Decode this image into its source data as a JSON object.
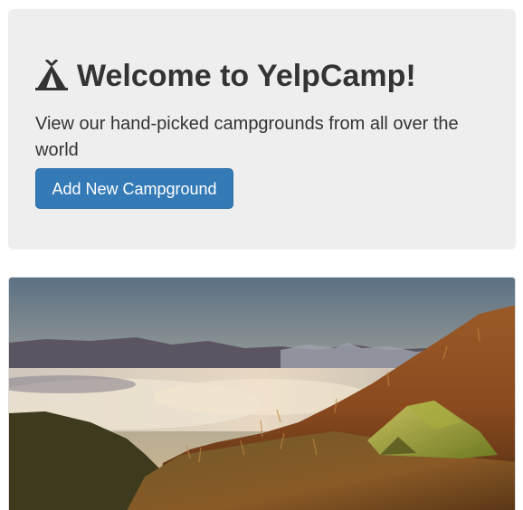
{
  "jumbotron": {
    "title": "Welcome to YelpCamp!",
    "subtitle": "View our hand-picked campgrounds from all over the world",
    "add_button_label": "Add New Campground",
    "title_icon": "tent-icon"
  },
  "campground_card": {
    "image": "campground-photo"
  },
  "colors": {
    "jumbotron_bg": "#eeeeee",
    "button_bg": "#337ab7",
    "text": "#333333"
  }
}
